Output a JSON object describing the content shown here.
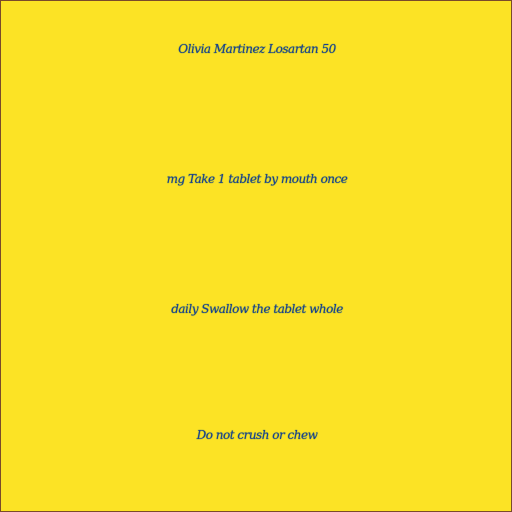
{
  "background_color": "#fce325",
  "text_color": "#1b3f8f",
  "lines": [
    "Olivia Martinez Losartan 50",
    "mg Take 1 tablet by mouth once",
    "daily Swallow the tablet whole",
    "Do not crush or chew"
  ]
}
